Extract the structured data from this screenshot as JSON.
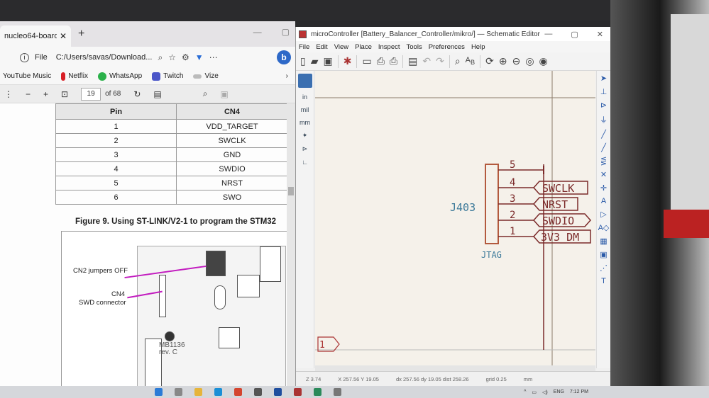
{
  "browser": {
    "tab_title": "nucleo64-board",
    "tab_close": "✕",
    "new_tab": "+",
    "file_label": "File",
    "url": "C:/Users/savas/Download...",
    "bookmarks": [
      "YouTube Music",
      "Netflix",
      "WhatsApp",
      "Twitch",
      "Vize"
    ],
    "pdf_toolbar": {
      "page": "19",
      "of_pages": "of 68"
    },
    "win_minimize": "—",
    "win_maximize": "▢"
  },
  "pdf": {
    "table_headers": [
      "Pin",
      "CN4"
    ],
    "table_rows": [
      [
        "1",
        "VDD_TARGET"
      ],
      [
        "2",
        "SWCLK"
      ],
      [
        "3",
        "GND"
      ],
      [
        "4",
        "SWDIO"
      ],
      [
        "5",
        "NRST"
      ],
      [
        "6",
        "SWO"
      ]
    ],
    "figure_caption": "Figure 9. Using ST-LINK/V2-1 to program the STM32",
    "label_cn2": "CN2 jumpers OFF",
    "label_cn4": "CN4",
    "label_swd": "SWD connector",
    "board_id": "MB1136",
    "board_rev": "rev. C"
  },
  "kicad": {
    "window_title": "microController [Battery_Balancer_Controller/mikro/] — Schematic Editor",
    "menu": [
      "File",
      "Edit",
      "View",
      "Place",
      "Inspect",
      "Tools",
      "Preferences",
      "Help"
    ],
    "left_tools": [
      "in",
      "mil",
      "mm"
    ],
    "symbol_ref": "J403",
    "symbol_value": "JTAG",
    "pins": [
      "5",
      "4",
      "3",
      "2",
      "1"
    ],
    "net_labels": [
      "SWCLK",
      "NRST",
      "SWDIO",
      "3V3_DM"
    ],
    "sheet_marker": "1",
    "status": {
      "zoom": "Z 3.74",
      "xy": "X 257.56  Y 19.05",
      "delta": "dx 257.56  dy 19.05  dist 258.26",
      "grid": "grid 0.25",
      "units": "mm"
    }
  },
  "taskbar": {
    "lang": "ENG",
    "time": "7:12 PM"
  },
  "colors": {
    "schematic_bg": "#f5f1ea",
    "schematic_line": "#7b2a2a",
    "symbol_body": "#b35a3e",
    "grid_button": "#3b6fb0",
    "highlight_arrow": "#c21bbf"
  }
}
